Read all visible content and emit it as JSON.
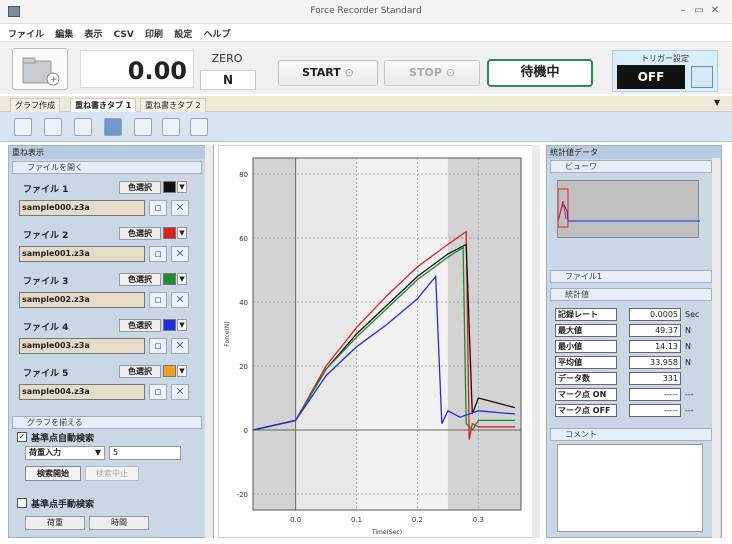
{
  "window": {
    "title": "Force Recorder Standard"
  },
  "menu": [
    "ファイル",
    "編集",
    "表示",
    "CSV",
    "印刷",
    "設定",
    "ヘルプ"
  ],
  "toolbar": {
    "value": "0.00",
    "zero_label": "ZERO",
    "unit": "N",
    "start_label": "START",
    "stop_label": "STOP",
    "status": "待機中",
    "trigger_title": "トリガー設定",
    "trigger_value": "OFF"
  },
  "tabs": [
    "グラフ作成",
    "重ね書きタブ 1",
    "重ね書きタブ 2"
  ],
  "left_panel": {
    "title": "重ね表示",
    "open_section": "ファイルを開く",
    "color_select": "色選択",
    "files": [
      {
        "label": "ファイル 1",
        "name": "sample000.z3a",
        "color": "#111111"
      },
      {
        "label": "ファイル 2",
        "name": "sample001.z3a",
        "color": "#e02020"
      },
      {
        "label": "ファイル 3",
        "name": "sample002.z3a",
        "color": "#1f8a2e"
      },
      {
        "label": "ファイル 4",
        "name": "sample003.z3a",
        "color": "#1f2ee0"
      },
      {
        "label": "ファイル 5",
        "name": "sample004.z3a",
        "color": "#f0a020"
      }
    ],
    "align_section": "グラフを揃える",
    "auto_detect": "基準点自動検索",
    "select_value": "荷重入力",
    "threshold": "5",
    "search_start": "検索開始",
    "search_stop": "検索中止",
    "manual_detect": "基準点手動検索",
    "col_load": "荷重",
    "col_time": "時間"
  },
  "chart_data": {
    "type": "line",
    "xlabel": "Time(Sec)",
    "ylabel": "Force(N)",
    "xlim": [
      -0.07,
      0.37
    ],
    "ylim": [
      -25,
      85
    ],
    "xticks": [
      "0.0",
      "0.1",
      "0.2",
      "0.3"
    ],
    "yticks": [
      "80",
      "60",
      "40",
      "20",
      "0",
      "-20"
    ],
    "series": [
      {
        "color": "#e02020",
        "x": [
          -0.07,
          0.0,
          0.05,
          0.1,
          0.15,
          0.2,
          0.25,
          0.28,
          0.285,
          0.29,
          0.3,
          0.36
        ],
        "y": [
          0,
          3,
          20,
          32,
          42,
          51,
          58,
          62,
          -3,
          2,
          1,
          1
        ]
      },
      {
        "color": "#111111",
        "x": [
          -0.07,
          0.0,
          0.05,
          0.1,
          0.15,
          0.2,
          0.25,
          0.28,
          0.29,
          0.3,
          0.36
        ],
        "y": [
          0,
          3,
          19,
          30,
          39,
          48,
          55,
          58,
          5,
          10,
          7
        ]
      },
      {
        "color": "#1f8a2e",
        "x": [
          -0.07,
          0.0,
          0.05,
          0.1,
          0.15,
          0.2,
          0.25,
          0.275,
          0.28,
          0.29,
          0.3,
          0.36
        ],
        "y": [
          0,
          3,
          19,
          29,
          38,
          47,
          54,
          57,
          2,
          0,
          3,
          3
        ]
      },
      {
        "color": "#1f2ee0",
        "x": [
          -0.07,
          0.0,
          0.05,
          0.1,
          0.15,
          0.2,
          0.23,
          0.24,
          0.25,
          0.27,
          0.3,
          0.36
        ],
        "y": [
          0,
          3,
          17,
          26,
          33,
          41,
          48,
          2,
          6,
          4,
          6,
          5
        ]
      }
    ]
  },
  "right_panel": {
    "title": "統計値データ",
    "preview": "ビューワ",
    "file_section": "ファイル1",
    "stats_section": "統計値",
    "stats": [
      {
        "label": "記録レート",
        "value": "0.0005",
        "unit": "Sec"
      },
      {
        "label": "最大値",
        "value": "49.37",
        "unit": "N"
      },
      {
        "label": "最小値",
        "value": "14.13",
        "unit": "N"
      },
      {
        "label": "平均値",
        "value": "33.958",
        "unit": "N"
      },
      {
        "label": "データ数",
        "value": "331",
        "unit": ""
      },
      {
        "label": "マーク点 ON",
        "value": "-----",
        "unit": "---"
      },
      {
        "label": "マーク点 OFF",
        "value": "-----",
        "unit": "---"
      }
    ],
    "comment_section": "コメント"
  }
}
